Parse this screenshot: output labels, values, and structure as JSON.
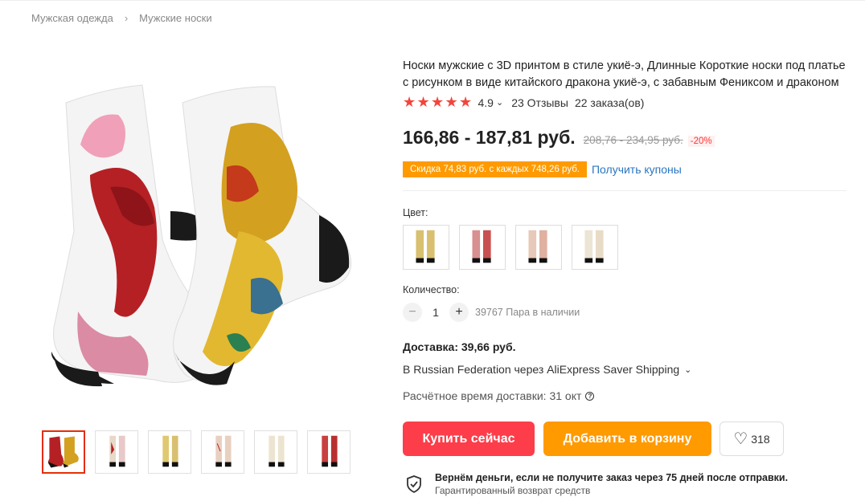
{
  "breadcrumb": [
    "Мужская одежда",
    "Мужские носки"
  ],
  "product": {
    "title": "Носки мужские с 3D принтом в стиле укиё-э, Длинные Короткие носки под платье с рисунком в виде китайского дракона укиё-э, с забавным Фениксом и драконом",
    "rating": "4.9",
    "reviews": "23 Отзывы",
    "orders": "22 заказа(ов)",
    "price": "166,86 - 187,81 руб.",
    "old_price": "208,76 - 234,95 руб.",
    "discount": "-20%",
    "coupon": "Скидка 74,83 руб. с каждых 748,26 руб.",
    "get_coupons": "Получить купоны"
  },
  "options": {
    "color_label": "Цвет:",
    "variants": [
      "variant-1",
      "variant-2",
      "variant-3",
      "variant-4"
    ],
    "quantity_label": "Количество:",
    "quantity": "1",
    "stock": "39767 Пара в наличии"
  },
  "shipping": {
    "cost": "Доставка: 39,66 руб.",
    "method": "В Russian Federation через AliExpress Saver Shipping",
    "eta": "Расчётное время доставки: 31 окт"
  },
  "actions": {
    "buy": "Купить сейчас",
    "cart": "Добавить в корзину",
    "wishlist_count": "318"
  },
  "guarantee": {
    "title": "Вернём деньги, если не получите заказ через 75 дней после отправки.",
    "subtitle": "Гарантированный возврат средств"
  },
  "colors": {
    "buy": "#fd3d4a",
    "cart": "#ff9a00",
    "star": "#f4443b",
    "link": "#2a75c0"
  }
}
